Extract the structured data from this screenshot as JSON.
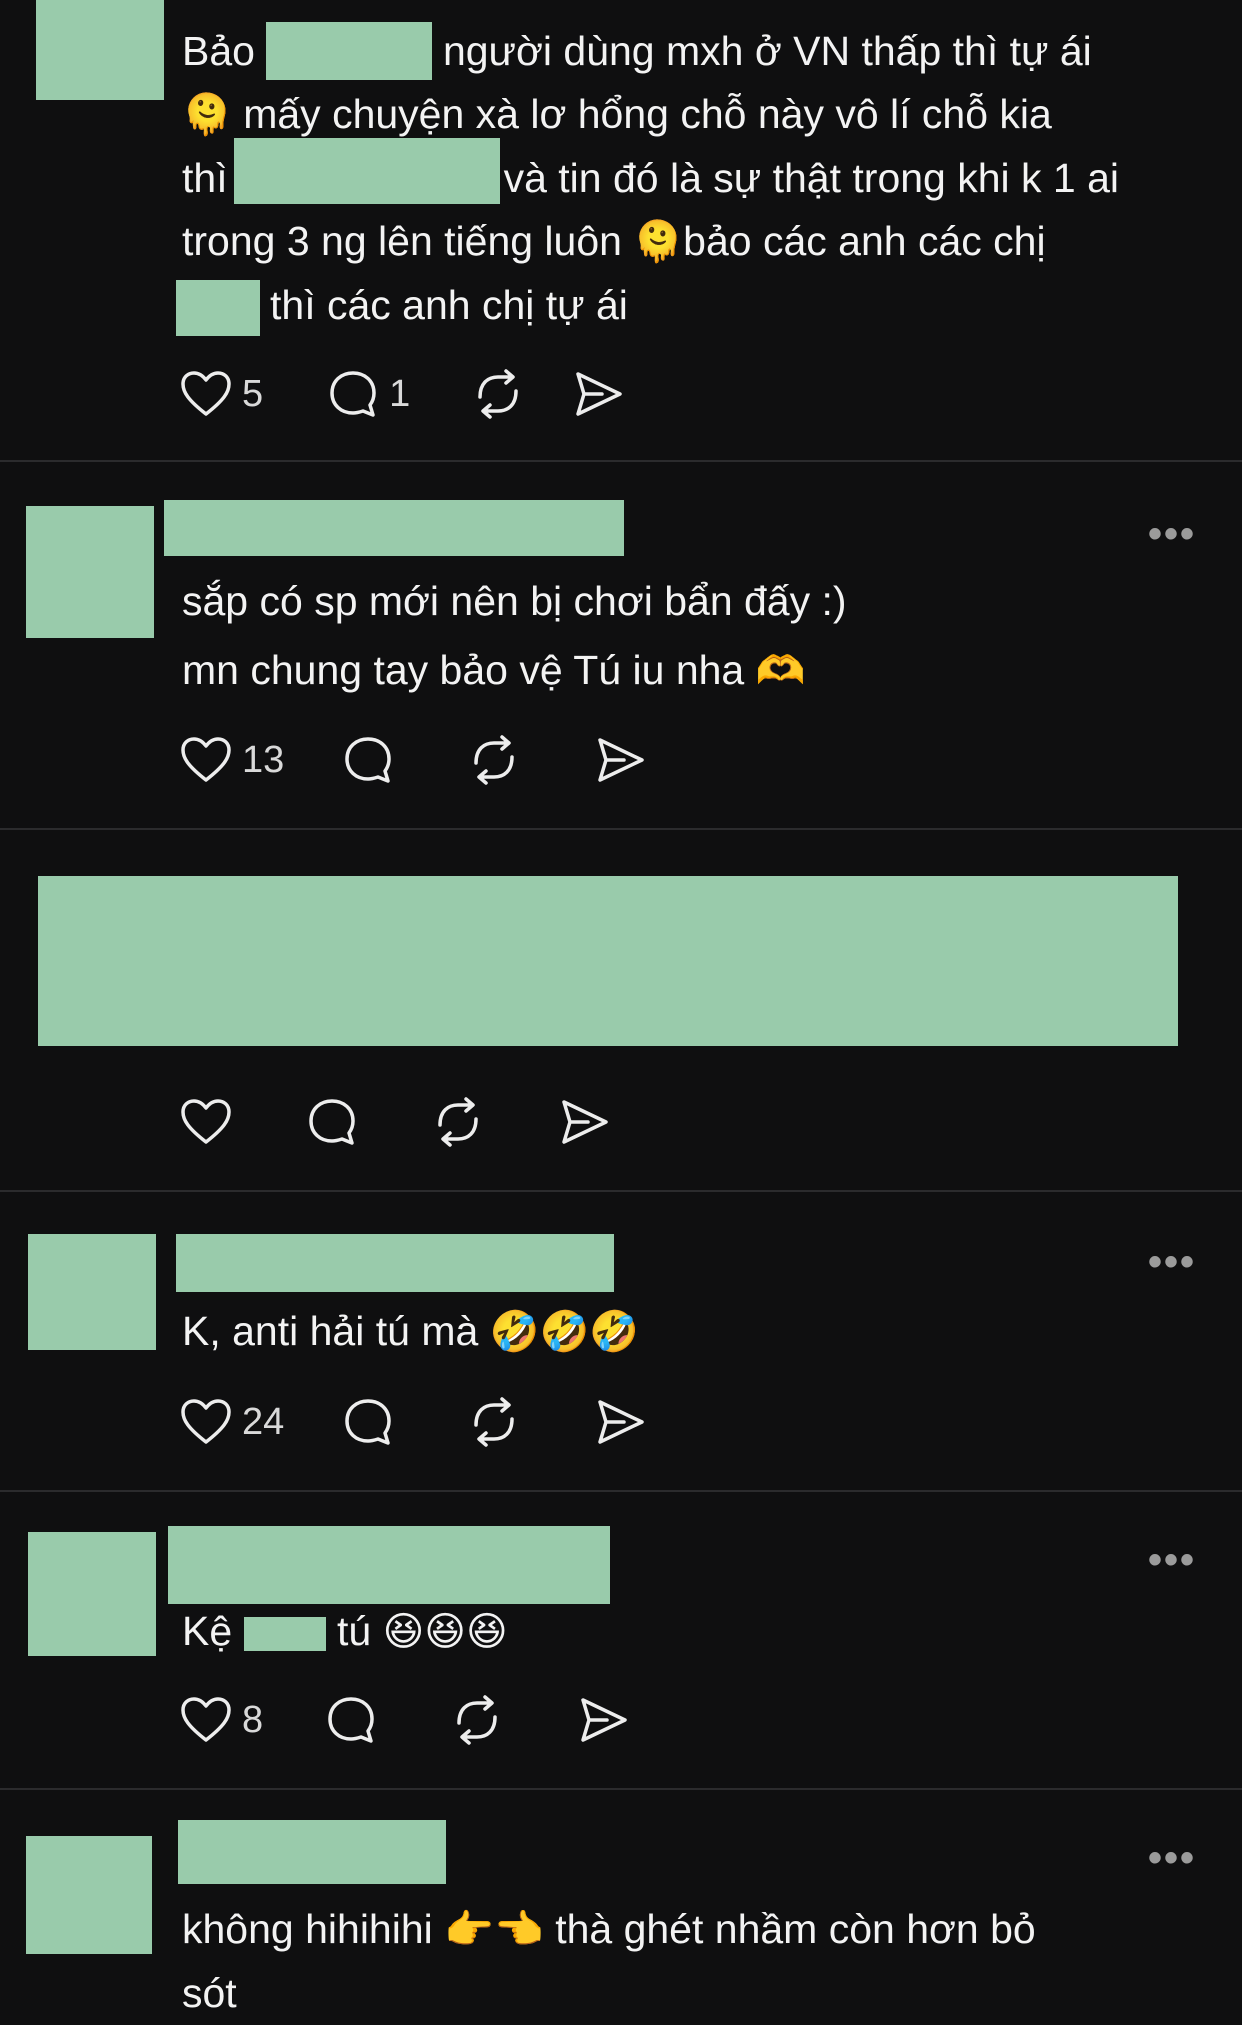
{
  "posts": [
    {
      "lines": [
        [
          "Bảo",
          "người dùng mxh ở VN thấp thì tự ái"
        ],
        [
          "mấy chuyện xà lơ hổng chỗ này vô lí chỗ kia"
        ],
        [
          "thì",
          "và tin đó là sự thật trong khi k 1 ai"
        ],
        [
          "trong 3 ng lên tiếng luôn",
          "bảo các anh các chị"
        ],
        [
          "thì các anh chị tự ái"
        ]
      ],
      "likes": "5",
      "replies": "1"
    },
    {
      "lines": [
        [
          "sắp có sp mới nên bị chơi bẩn đấy :)"
        ],
        [
          "mn chung tay bảo vệ Tú iu nha"
        ]
      ],
      "likes": "13",
      "more": "•••"
    },
    {
      "likes": ""
    },
    {
      "lines": [
        [
          "K, anti hải tú mà"
        ]
      ],
      "likes": "24",
      "more": "•••"
    },
    {
      "lines": [
        [
          "Kệ",
          "tú"
        ]
      ],
      "likes": "8",
      "more": "•••"
    },
    {
      "lines": [
        [
          "không hihihihi",
          "thà ghét nhầm còn hơn bỏ"
        ],
        [
          "sót"
        ]
      ],
      "more": "•••"
    }
  ],
  "emoji": {
    "melting_face": "🫠",
    "heart_hands": "🫶",
    "rofl": "🤣",
    "grin_squint": "😆",
    "point_right": "👉",
    "point_left": "👈"
  },
  "colors": {
    "background": "#0f0f10",
    "redaction": "#99cbab",
    "divider": "#2b2b2d"
  },
  "icons": [
    "heart-icon",
    "comment-icon",
    "repost-icon",
    "share-icon",
    "more-icon"
  ]
}
